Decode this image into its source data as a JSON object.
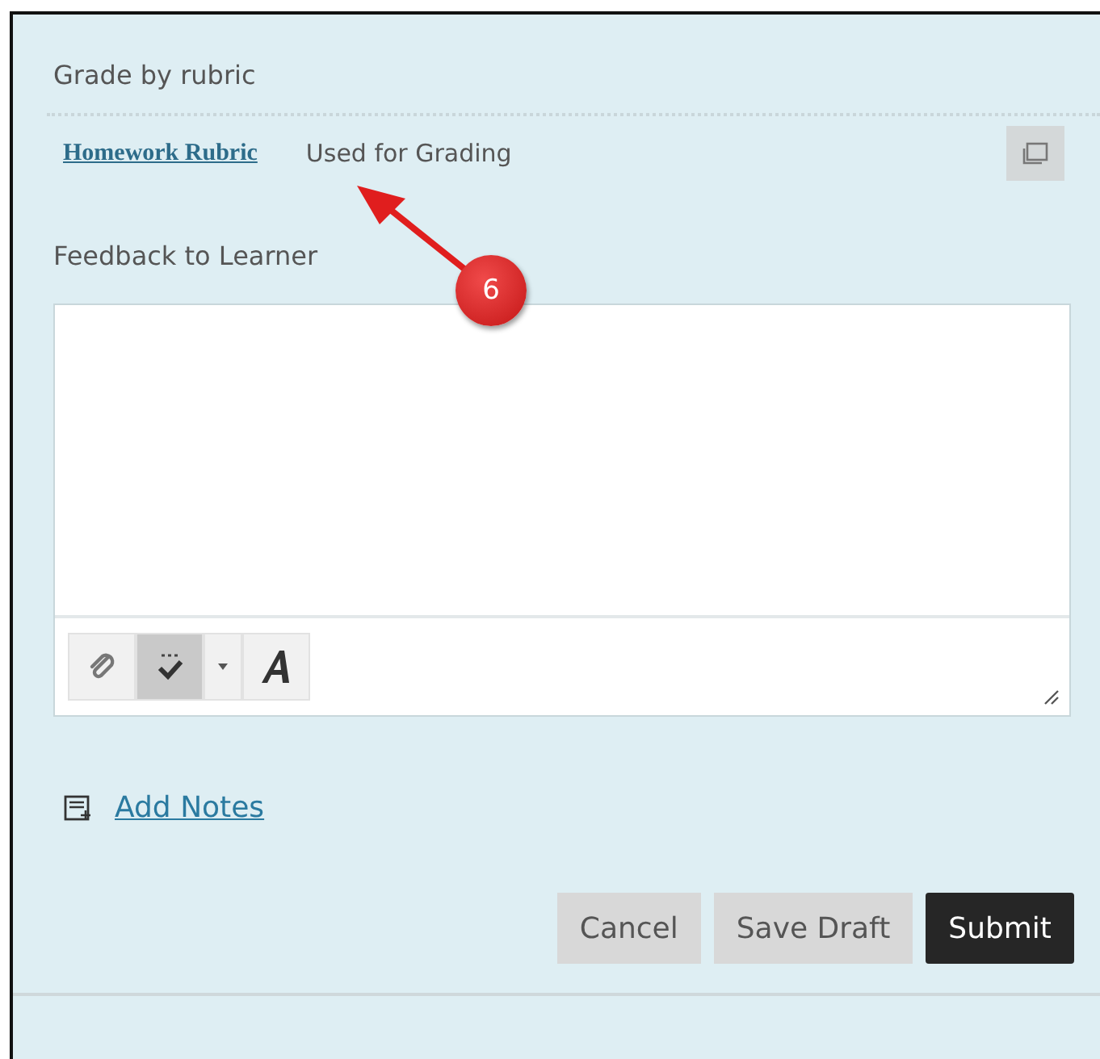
{
  "section_title": "Grade by rubric",
  "rubric": {
    "link": "Homework Rubric",
    "status": "Used for Grading"
  },
  "callout": {
    "number": "6"
  },
  "feedback": {
    "label": "Feedback to Learner"
  },
  "toolbar": [
    {
      "kind": "attach",
      "selected": false
    },
    {
      "kind": "spellcheck",
      "selected": true
    },
    {
      "kind": "dropdown",
      "selected": false
    },
    {
      "kind": "format",
      "selected": false
    }
  ],
  "add_notes": "Add Notes",
  "buttons": [
    {
      "label": "Cancel",
      "kind": "secondary"
    },
    {
      "label": "Save Draft",
      "kind": "secondary"
    },
    {
      "label": "Submit",
      "kind": "primary"
    }
  ]
}
